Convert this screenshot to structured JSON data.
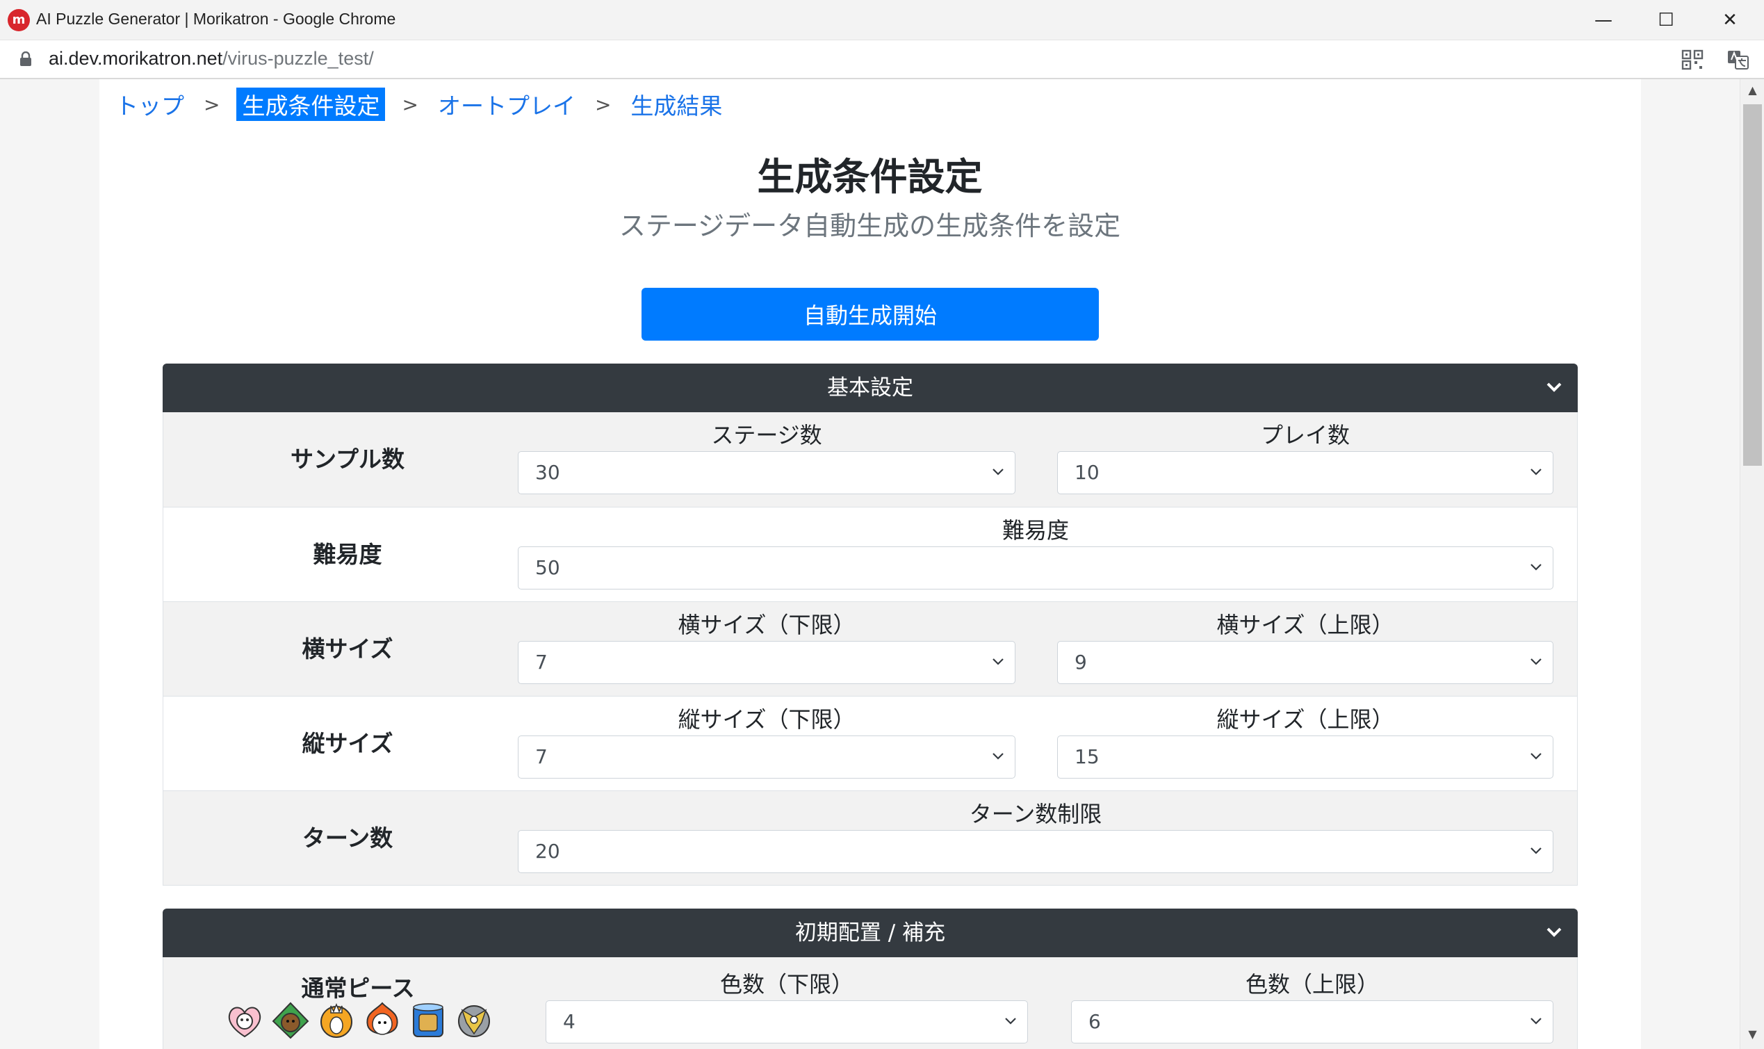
{
  "window": {
    "title": "AI Puzzle Generator | Morikatron - Google Chrome",
    "app_icon_glyph": "m"
  },
  "controls": {
    "minimize": "—",
    "maximize": "☐",
    "close": "✕"
  },
  "address": {
    "host": "ai.dev.morikatron.net",
    "path": "/virus-puzzle_test/"
  },
  "breadcrumb": {
    "items": [
      "トップ",
      "生成条件設定",
      "オートプレイ",
      "生成結果"
    ],
    "separator": ">"
  },
  "page": {
    "title": "生成条件設定",
    "subtitle": "ステージデータ自動生成の生成条件を設定",
    "start_button": "自動生成開始"
  },
  "sections": {
    "basic": {
      "title": "基本設定",
      "rows": [
        {
          "label": "サンプル数",
          "fields": [
            {
              "label": "ステージ数",
              "value": "30"
            },
            {
              "label": "プレイ数",
              "value": "10"
            }
          ]
        },
        {
          "label": "難易度",
          "fields": [
            {
              "label": "難易度",
              "value": "50"
            }
          ]
        },
        {
          "label": "横サイズ",
          "fields": [
            {
              "label": "横サイズ（下限）",
              "value": "7"
            },
            {
              "label": "横サイズ（上限）",
              "value": "9"
            }
          ]
        },
        {
          "label": "縦サイズ",
          "fields": [
            {
              "label": "縦サイズ（下限）",
              "value": "7"
            },
            {
              "label": "縦サイズ（上限）",
              "value": "15"
            }
          ]
        },
        {
          "label": "ターン数",
          "fields": [
            {
              "label": "ターン数制限",
              "value": "20"
            }
          ]
        }
      ]
    },
    "initial": {
      "title": "初期配置 / 補充",
      "piece_label": "通常ピース",
      "fields": [
        {
          "label": "色数（下限）",
          "value": "4"
        },
        {
          "label": "色数（上限）",
          "value": "6"
        }
      ]
    }
  },
  "colors": {
    "accent": "#007bff",
    "section_header": "#343a40",
    "row_shade": "#f2f2f2"
  }
}
